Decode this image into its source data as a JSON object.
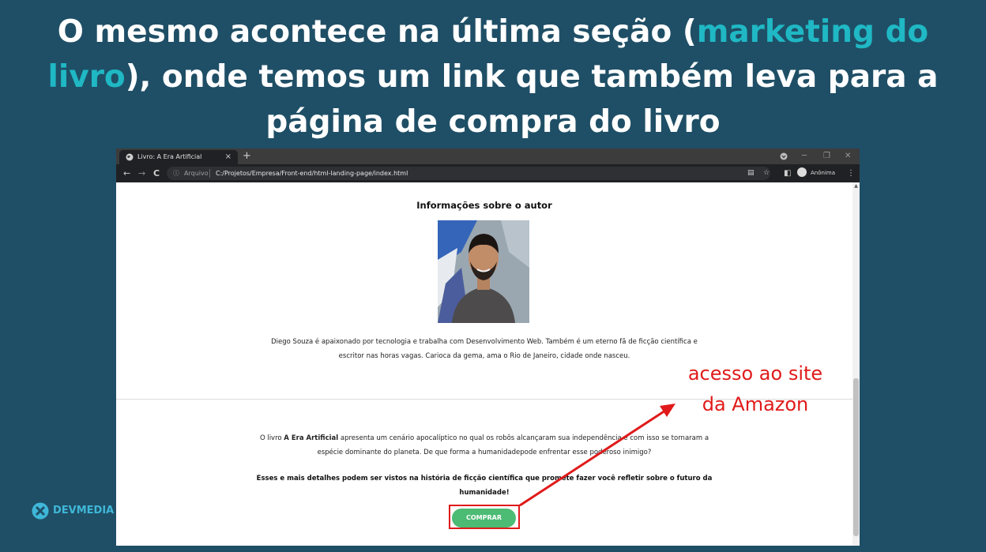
{
  "slide": {
    "title_before": "O mesmo acontece na última seção (",
    "title_highlight": "marketing do livro",
    "title_after": "), onde temos um link que também leva para a página de compra do livro",
    "highlight_color": "#1fb8c4",
    "background_color": "#1f4f66"
  },
  "browser": {
    "tab_title": "Livro: A Era Artificial",
    "tab_close": "×",
    "new_tab": "+",
    "window_controls": {
      "minimize": "─",
      "maximize": "❐",
      "close": "✕"
    },
    "nav": {
      "back": "←",
      "forward": "→",
      "reload": "C"
    },
    "address": {
      "scheme_label": "Arquivo",
      "url": "C:/Projetos/Empresa/Front-end/html-landing-page/index.html"
    },
    "profile_name": "Anônima",
    "menu": "⋮"
  },
  "page": {
    "author_heading": "Informações sobre o autor",
    "bio": "Diego Souza é apaixonado por tecnologia e trabalha com Desenvolvimento Web. Também é um eterno fã de ficção científica e escritor nas horas vagas. Carioca da gema, ama o Rio de Janeiro, cidade onde nasceu.",
    "book_desc_prefix": "O livro ",
    "book_title": "A Era Artificial",
    "book_desc_suffix": " apresenta um cenário apocalíptico no qual os robôs alcançaram sua independência e com isso se tornaram a espécie dominante do planeta. De que forma a humanidadepode enfrentar esse poderoso inimigo?",
    "cta_text": "Esses e mais detalhes podem ser vistos na história de ficção científica que promete fazer você refletir sobre o futuro da humanidade!",
    "buy_button": "COMPRAR",
    "buy_button_color": "#4cbb74"
  },
  "annotation": {
    "line1": "acesso ao site",
    "line2": "da Amazon",
    "color": "#e01a1a"
  },
  "logo": {
    "text": "DEVMEDIA"
  }
}
